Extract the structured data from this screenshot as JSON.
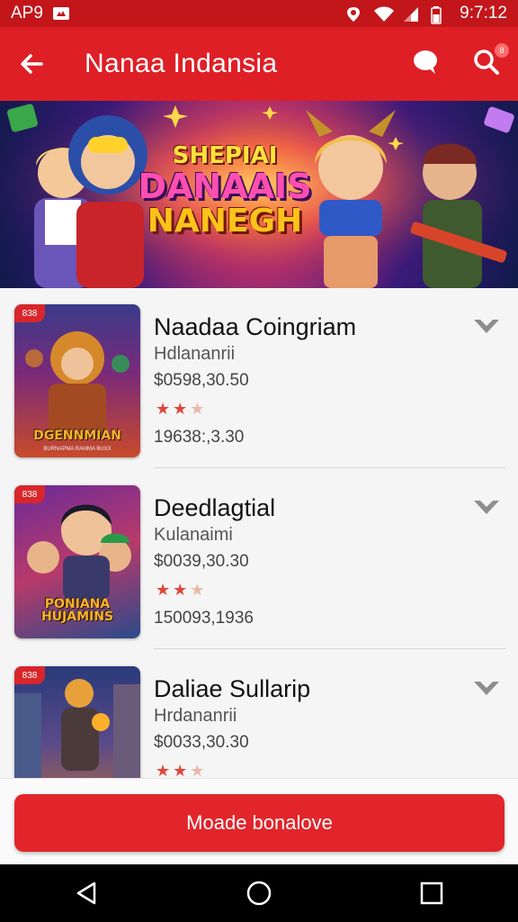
{
  "status_bar": {
    "carrier": "AP9",
    "time": "9:7:12",
    "icons": [
      "notification-icon",
      "location-icon",
      "wifi-icon",
      "signal-icon",
      "battery-icon"
    ]
  },
  "app_bar": {
    "title": "Nanaa Indansia",
    "back_icon": "back-arrow-icon",
    "chat_icon": "chat-icon",
    "search_icon": "search-icon",
    "badge": "8"
  },
  "banner": {
    "line1": "SHEPIAI",
    "line2": "DANAAIS",
    "line3": "NANEGH"
  },
  "items": [
    {
      "title": "Naadaa Coingriam",
      "subtitle": "Hdlananrii",
      "price": "$0598,30.50",
      "rating": 2,
      "count": "19638:,3.30",
      "thumb_title": "DGENNMIAN",
      "thumb_sub": "BURNAPMA RAMMA BUXX",
      "age": "838"
    },
    {
      "title": "Deedlagtial",
      "subtitle": "Kulanaimi",
      "price": "$0039,30.30",
      "rating": 2,
      "count": "150093,1936",
      "thumb_title": "PONIANA HUJAMINS",
      "thumb_sub": "",
      "age": "838"
    },
    {
      "title": "Daliae Sullarip",
      "subtitle": "Hrdananrii",
      "price": "$0033,30.30",
      "rating": 2,
      "count": "",
      "thumb_title": "",
      "thumb_sub": "",
      "age": "838"
    }
  ],
  "main_button": {
    "label": "Moade bonalove"
  },
  "nav": {
    "back": "nav-back-icon",
    "home": "nav-home-icon",
    "recents": "nav-recents-icon"
  },
  "colors": {
    "primary": "#de1f26",
    "status": "#c2161b",
    "star": "#e0463a"
  }
}
